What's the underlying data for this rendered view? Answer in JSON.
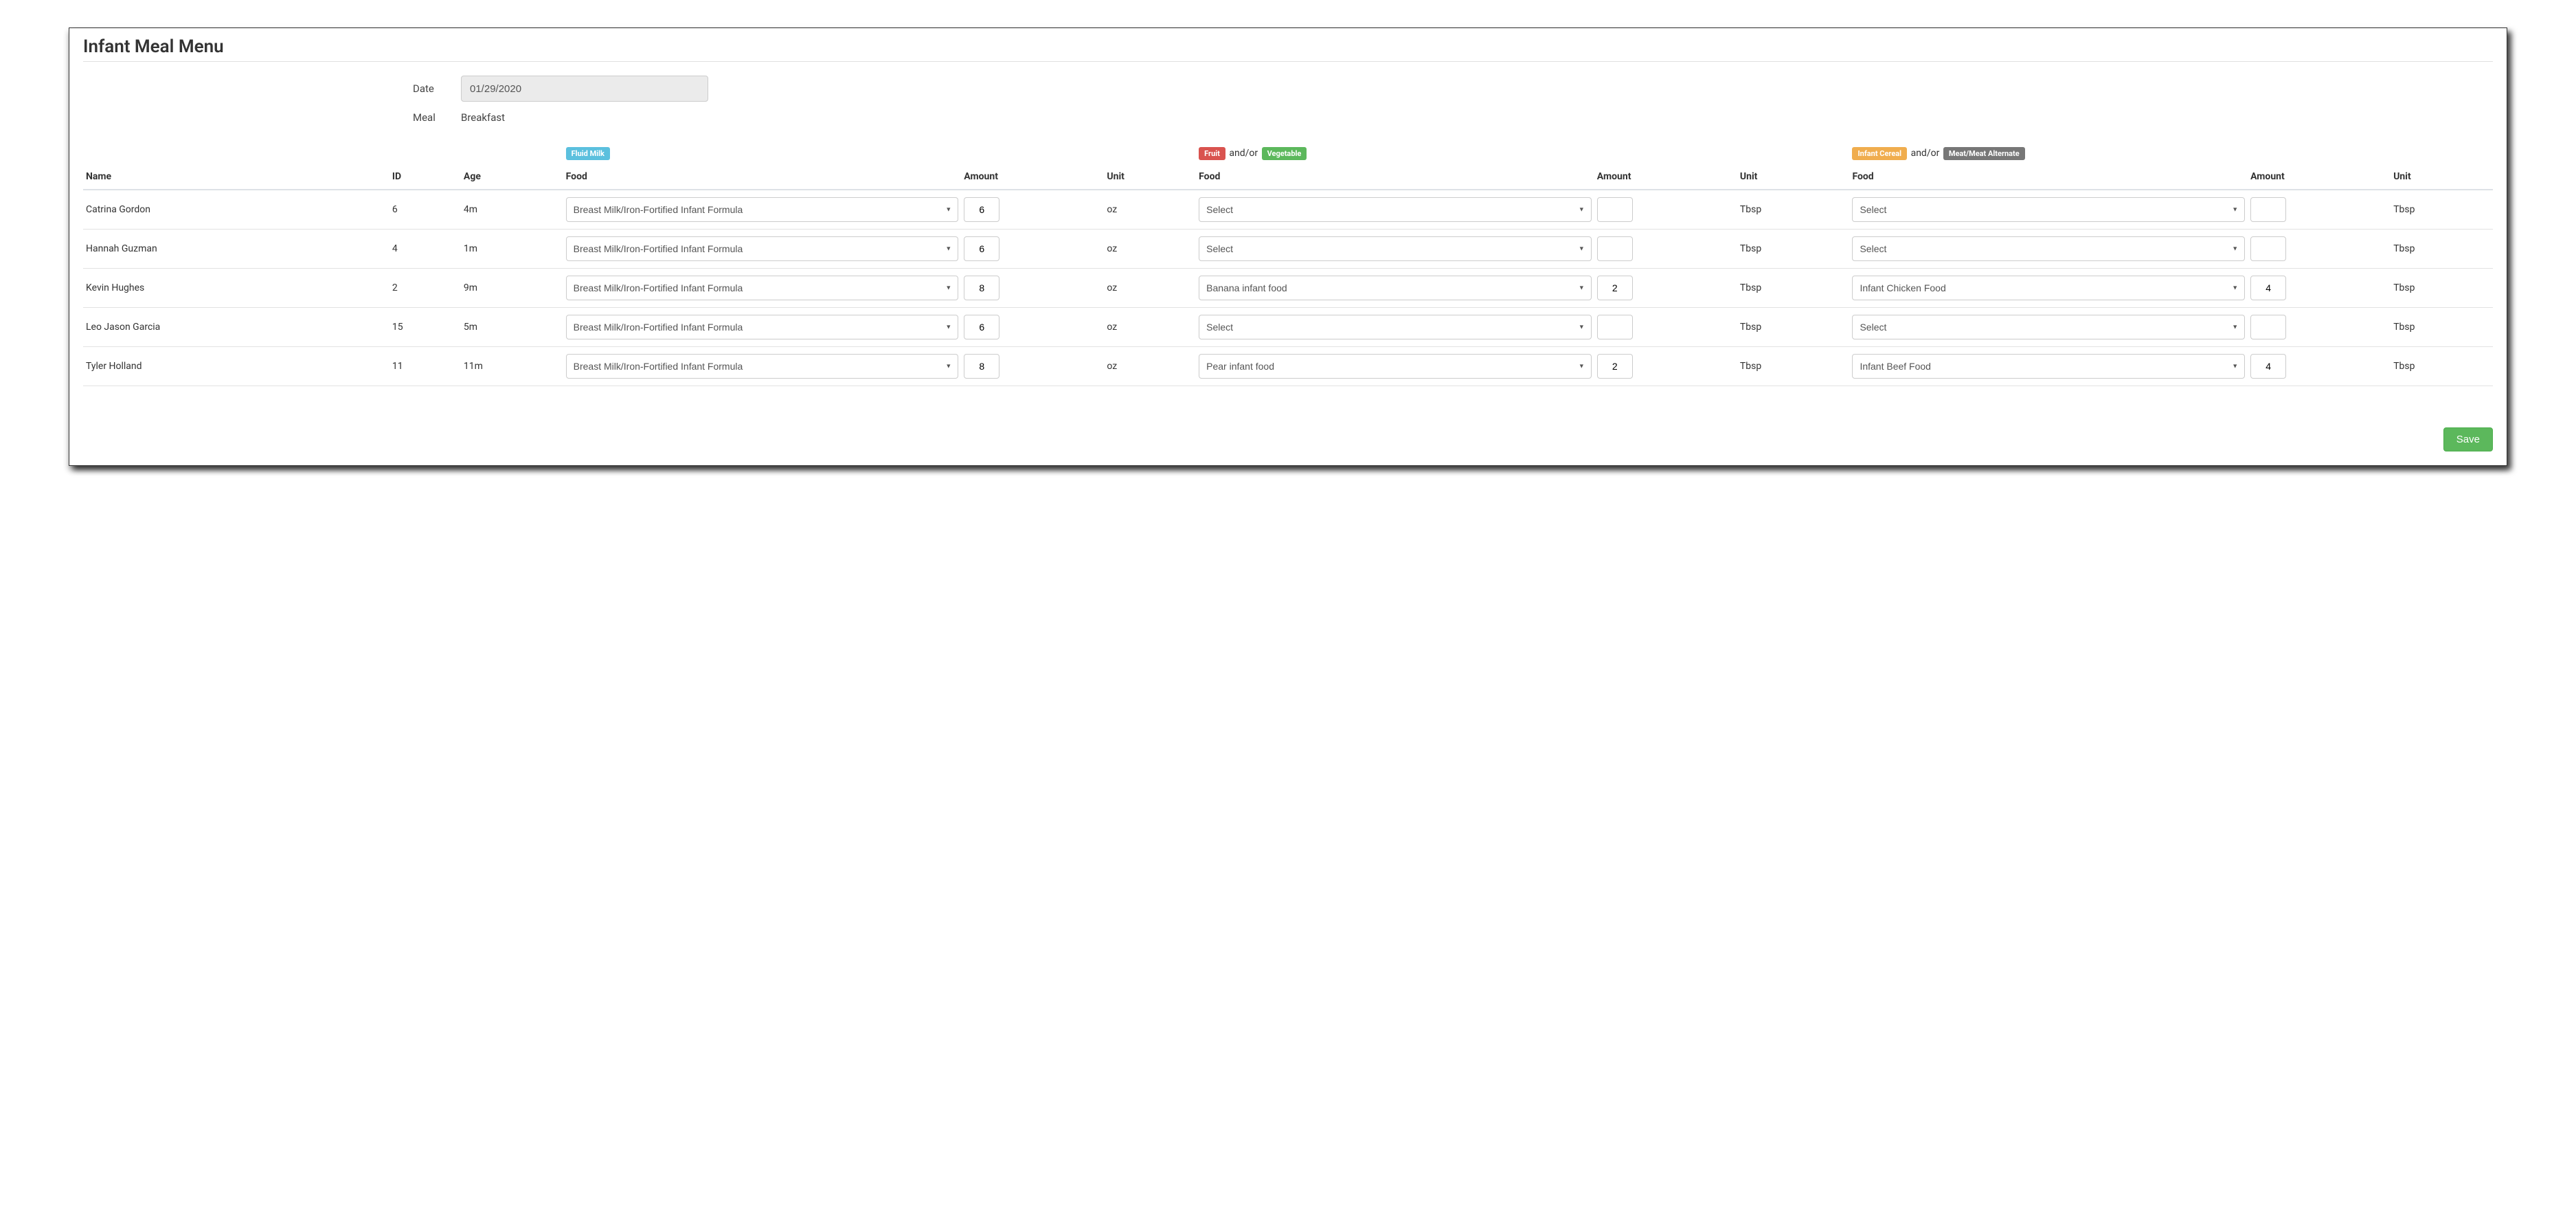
{
  "title": "Infant Meal Menu",
  "info": {
    "date_label": "Date",
    "date_value": "01/29/2020",
    "meal_label": "Meal",
    "meal_value": "Breakfast"
  },
  "groups": {
    "milk_badge": "Fluid Milk",
    "fruit_badge": "Fruit",
    "andor": "and/or",
    "veg_badge": "Vegetable",
    "cereal_badge": "Infant Cereal",
    "meat_badge": "Meat/Meat Alternate"
  },
  "headers": {
    "name": "Name",
    "id": "ID",
    "age": "Age",
    "food": "Food",
    "amount": "Amount",
    "unit": "Unit"
  },
  "units": {
    "oz": "oz",
    "tbsp": "Tbsp"
  },
  "select_placeholder": "Select",
  "milk_option": "Breast Milk/Iron-Fortified Infant Formula",
  "rows": [
    {
      "name": "Catrina Gordon",
      "id": "6",
      "age": "4m",
      "milk_amount": "6",
      "fv_food": "Select",
      "fv_amount": "",
      "cm_food": "Select",
      "cm_amount": ""
    },
    {
      "name": "Hannah Guzman",
      "id": "4",
      "age": "1m",
      "milk_amount": "6",
      "fv_food": "Select",
      "fv_amount": "",
      "cm_food": "Select",
      "cm_amount": ""
    },
    {
      "name": "Kevin Hughes",
      "id": "2",
      "age": "9m",
      "milk_amount": "8",
      "fv_food": "Banana infant food",
      "fv_amount": "2",
      "cm_food": "Infant Chicken Food",
      "cm_amount": "4"
    },
    {
      "name": "Leo Jason Garcia",
      "id": "15",
      "age": "5m",
      "milk_amount": "6",
      "fv_food": "Select",
      "fv_amount": "",
      "cm_food": "Select",
      "cm_amount": ""
    },
    {
      "name": "Tyler Holland",
      "id": "11",
      "age": "11m",
      "milk_amount": "8",
      "fv_food": "Pear infant food",
      "fv_amount": "2",
      "cm_food": "Infant Beef Food",
      "cm_amount": "4"
    }
  ],
  "buttons": {
    "save": "Save"
  }
}
